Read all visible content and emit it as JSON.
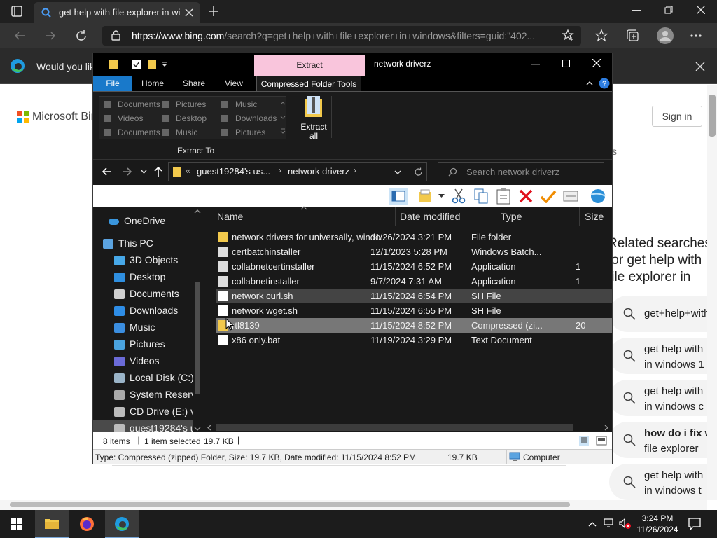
{
  "browser": {
    "tab_title": "get help with file explorer in windows",
    "url_host": "https://www.bing.com",
    "url_path": "/search?q=get+help+with+file+explorer+in+windows&filters=guid:\"402...",
    "infobar_text": "Would you like",
    "bing_logo_text": "Microsoft Bing",
    "sign_in": "Sign in",
    "related_heading": "Related searches for get help with file explorer in windows",
    "related": [
      {
        "line1": "get+help+with"
      },
      {
        "line1": "get help with",
        "line2": "in windows 1"
      },
      {
        "line1": "get help with",
        "line2": "in windows c"
      },
      {
        "line1": "how do i fix w",
        "line2": "file explorer"
      },
      {
        "line1": "get help with",
        "line2": "in windows t"
      }
    ],
    "stray_letter": "s"
  },
  "explorer": {
    "window_title": "network driverz",
    "context_tab": "Extract",
    "ribbon_tabs": [
      "File",
      "Home",
      "Share",
      "View",
      "Compressed Folder Tools"
    ],
    "extract_to_items": [
      [
        "Documents",
        "Pictures",
        "Music"
      ],
      [
        "Videos",
        "Desktop",
        "Downloads"
      ],
      [
        "Documents",
        "Music",
        "Pictures"
      ]
    ],
    "extract_to_label": "Extract To",
    "extract_all_line1": "Extract",
    "extract_all_line2": "all",
    "breadcrumb": [
      "guest19284's us...",
      "network driverz"
    ],
    "search_placeholder": "Search network driverz",
    "nav_items": [
      {
        "label": "OneDrive",
        "icon": "cloud-icon",
        "color": "#3a96dd"
      },
      {
        "label": "This PC",
        "icon": "computer-icon",
        "color": "#5ba3e0"
      },
      {
        "label": "3D Objects",
        "icon": "cube-icon",
        "color": "#47a8e8"
      },
      {
        "label": "Desktop",
        "icon": "desktop-icon",
        "color": "#2f8fe0"
      },
      {
        "label": "Documents",
        "icon": "document-icon",
        "color": "#cfcfcf"
      },
      {
        "label": "Downloads",
        "icon": "download-icon",
        "color": "#2e8de6"
      },
      {
        "label": "Music",
        "icon": "music-icon",
        "color": "#3b8ee0"
      },
      {
        "label": "Pictures",
        "icon": "pictures-icon",
        "color": "#4aa3df"
      },
      {
        "label": "Videos",
        "icon": "videos-icon",
        "color": "#6b6bd8"
      },
      {
        "label": "Local Disk (C:)",
        "icon": "drive-icon",
        "color": "#9ab4c8"
      },
      {
        "label": "System Reserved",
        "icon": "drive-icon",
        "color": "#aaaaaa"
      },
      {
        "label": "CD Drive (E:) vi",
        "icon": "cd-icon",
        "color": "#bbbbbb"
      },
      {
        "label": "guest19284's u",
        "icon": "network-drive-icon",
        "color": "#bbbbbb"
      }
    ],
    "columns": [
      "Name",
      "Date modified",
      "Type",
      "Size"
    ],
    "files": [
      {
        "name": "network drivers for universally, windo...",
        "date": "11/26/2024 3:21 PM",
        "type": "File folder",
        "size": "",
        "icon": "folder-icon",
        "color": "#f2c94c"
      },
      {
        "name": "certbatchinstaller",
        "date": "12/1/2023 5:28 PM",
        "type": "Windows Batch...",
        "size": "",
        "icon": "gear-file-icon",
        "color": "#dddddd"
      },
      {
        "name": "collabnetcertinstaller",
        "date": "11/15/2024 6:52 PM",
        "type": "Application",
        "size": "1",
        "icon": "app-icon",
        "color": "#dddddd"
      },
      {
        "name": "collabnetinstaller",
        "date": "9/7/2024 7:31 AM",
        "type": "Application",
        "size": "1",
        "icon": "app-icon",
        "color": "#dddddd"
      },
      {
        "name": "network curl.sh",
        "date": "11/15/2024 6:54 PM",
        "type": "SH File",
        "size": "",
        "icon": "file-icon",
        "color": "#ffffff"
      },
      {
        "name": "network wget.sh",
        "date": "11/15/2024 6:55 PM",
        "type": "SH File",
        "size": "",
        "icon": "file-icon",
        "color": "#ffffff"
      },
      {
        "name": "rtl8139",
        "date": "11/15/2024 8:52 PM",
        "type": "Compressed (zi...",
        "size": "20",
        "icon": "zip-folder-icon",
        "color": "#f2c94c"
      },
      {
        "name": "x86 only.bat",
        "date": "11/19/2024 3:29 PM",
        "type": "Text Document",
        "size": "",
        "icon": "text-file-icon",
        "color": "#ffffff"
      }
    ],
    "status_items": "8 items",
    "status_selected": "1 item selected",
    "status_size": "19.7 KB",
    "detail_text": "Type: Compressed (zipped) Folder, Size: 19.7 KB, Date modified: 11/15/2024 8:52 PM",
    "detail_size": "19.7 KB",
    "detail_location": "Computer"
  },
  "taskbar": {
    "time": "3:24 PM",
    "date": "11/26/2024"
  }
}
